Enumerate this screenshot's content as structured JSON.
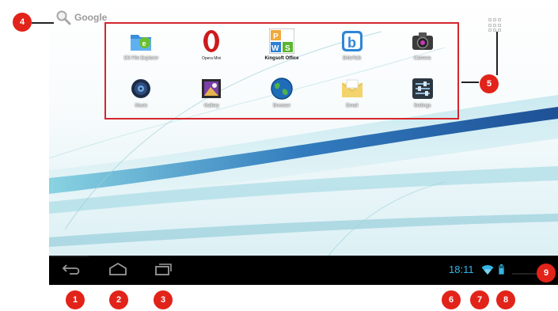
{
  "search": {
    "label": "Google"
  },
  "apps": [
    {
      "label": "ES File Explorer",
      "icon": "es-file-explorer-icon"
    },
    {
      "label": "Opera Mini",
      "icon": "opera-mini-icon"
    },
    {
      "label": "Kingsoft Office",
      "icon": "kingsoft-office-icon"
    },
    {
      "label": "BriteTalk",
      "icon": "britetalk-icon"
    },
    {
      "label": "Camera",
      "icon": "camera-icon"
    },
    {
      "label": "Music",
      "icon": "music-icon"
    },
    {
      "label": "Gallery",
      "icon": "gallery-icon"
    },
    {
      "label": "Browser",
      "icon": "browser-icon"
    },
    {
      "label": "Email",
      "icon": "email-icon"
    },
    {
      "label": "Settings",
      "icon": "settings-icon"
    }
  ],
  "status_bar": {
    "time": "18:11"
  },
  "callouts": [
    "1",
    "2",
    "3",
    "4",
    "5",
    "6",
    "7",
    "8",
    "9"
  ],
  "colors": {
    "callout": "#e2231a",
    "clock": "#33b5e5",
    "nav_bar": "#000000"
  }
}
